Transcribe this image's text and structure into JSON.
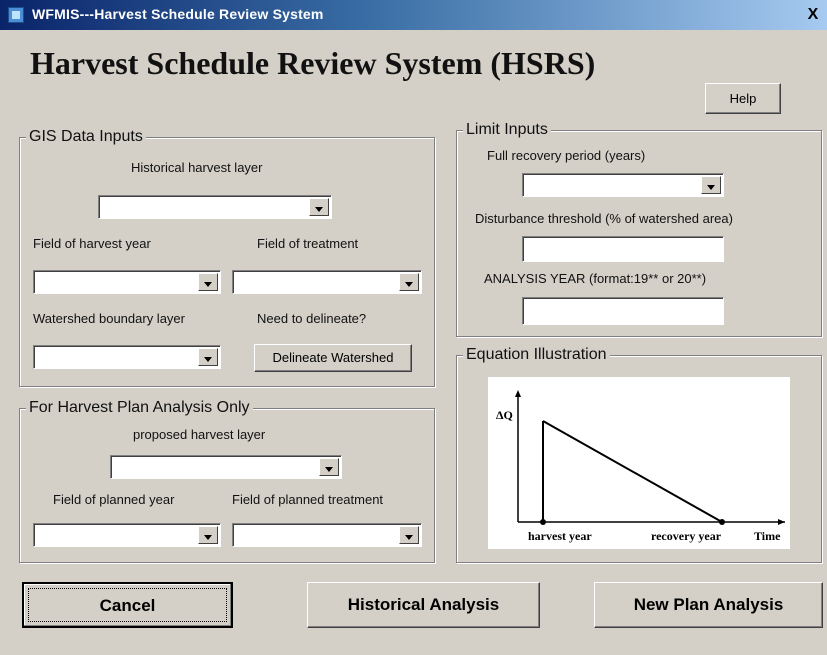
{
  "window": {
    "title": "WFMIS---Harvest Schedule Review System",
    "close_label": "X"
  },
  "main_title": "Harvest Schedule Review System (HSRS)",
  "help_label": "Help",
  "gis_inputs": {
    "legend": "GIS Data Inputs",
    "historical_layer_label": "Historical harvest layer",
    "harvest_year_label": "Field of harvest year",
    "treatment_label": "Field of treatment",
    "watershed_label": "Watershed boundary layer",
    "delineate_question": "Need to delineate?",
    "delineate_button": "Delineate Watershed"
  },
  "harvest_plan": {
    "legend": "For Harvest Plan Analysis Only",
    "proposed_layer_label": "proposed harvest layer",
    "planned_year_label": "Field of planned year",
    "planned_treatment_label": "Field of planned treatment"
  },
  "limit_inputs": {
    "legend": "Limit Inputs",
    "recovery_label": "Full recovery period (years)",
    "threshold_label": "Disturbance threshold (% of watershed area)",
    "analysis_year_label": "ANALYSIS YEAR (format:19** or 20**)"
  },
  "equation": {
    "legend": "Equation Illustration",
    "y_label": "ΔQ",
    "harvest_year": "harvest year",
    "recovery_year": "recovery year",
    "time_label": "Time"
  },
  "buttons": {
    "cancel": "Cancel",
    "historical": "Historical Analysis",
    "new_plan": "New Plan Analysis"
  }
}
